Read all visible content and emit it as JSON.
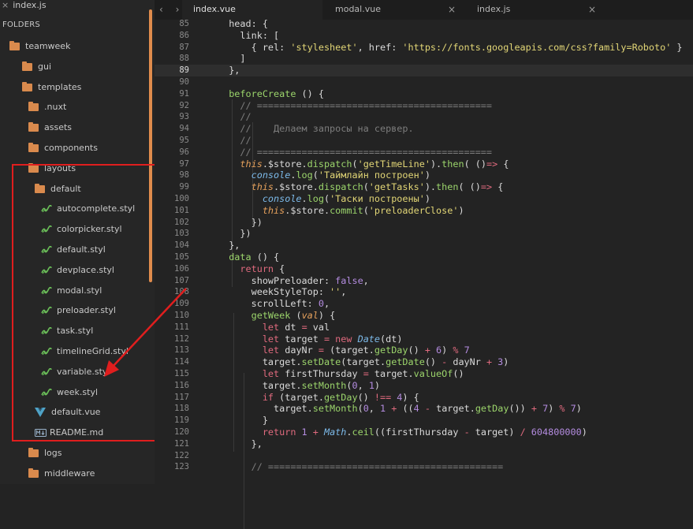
{
  "sidebar": {
    "open_file": "index.js",
    "folders_label": "FOLDERS",
    "items": [
      {
        "label": "teamweek",
        "type": "folder"
      },
      {
        "label": "gui",
        "type": "folder"
      },
      {
        "label": "templates",
        "type": "folder"
      },
      {
        "label": ".nuxt",
        "type": "folder"
      },
      {
        "label": "assets",
        "type": "folder"
      },
      {
        "label": "components",
        "type": "folder"
      },
      {
        "label": "layouts",
        "type": "folder"
      },
      {
        "label": "default",
        "type": "folder"
      },
      {
        "label": "autocomplete.styl",
        "type": "styl"
      },
      {
        "label": "colorpicker.styl",
        "type": "styl"
      },
      {
        "label": "default.styl",
        "type": "styl"
      },
      {
        "label": "devplace.styl",
        "type": "styl"
      },
      {
        "label": "modal.styl",
        "type": "styl"
      },
      {
        "label": "preloader.styl",
        "type": "styl"
      },
      {
        "label": "task.styl",
        "type": "styl"
      },
      {
        "label": "timelineGrid.styl",
        "type": "styl"
      },
      {
        "label": "variable.styl",
        "type": "styl"
      },
      {
        "label": "week.styl",
        "type": "styl"
      },
      {
        "label": "default.vue",
        "type": "vue"
      },
      {
        "label": "README.md",
        "type": "md"
      },
      {
        "label": "logs",
        "type": "folder"
      },
      {
        "label": "middleware",
        "type": "folder"
      }
    ]
  },
  "tabs": [
    {
      "label": "index.vue",
      "active": true
    },
    {
      "label": "modal.vue",
      "active": false
    },
    {
      "label": "index.js",
      "active": false
    }
  ],
  "nav_arrows": "‹ ›",
  "current_line": 89,
  "colors": {
    "annotation_red": "#e01e1e",
    "folder_orange": "#d98a4d",
    "keyword": "#e06a7e",
    "string": "#e2d676",
    "function": "#9bd46b"
  },
  "code_lines": [
    {
      "n": 85,
      "tokens": [
        [
          "a",
          "  head: {"
        ]
      ]
    },
    {
      "n": 86,
      "tokens": [
        [
          "a",
          "    link: ["
        ]
      ]
    },
    {
      "n": 87,
      "tokens": [
        [
          "a",
          "      { rel: "
        ],
        [
          "s",
          "'stylesheet'"
        ],
        [
          "a",
          ", href: "
        ],
        [
          "s",
          "'https://fonts.googleapis.com/css?family=Roboto'"
        ],
        [
          "a",
          " }"
        ]
      ]
    },
    {
      "n": 88,
      "tokens": [
        [
          "a",
          "    ]"
        ]
      ]
    },
    {
      "n": 89,
      "tokens": [
        [
          "a",
          "  },"
        ]
      ]
    },
    {
      "n": 90,
      "tokens": [
        [
          "a",
          ""
        ]
      ]
    },
    {
      "n": 91,
      "tokens": [
        [
          "f",
          "  beforeCreate"
        ],
        [
          "a",
          " () {"
        ]
      ]
    },
    {
      "n": 92,
      "tokens": [
        [
          "c",
          "    // =========================================="
        ]
      ]
    },
    {
      "n": 93,
      "tokens": [
        [
          "c",
          "    //"
        ]
      ]
    },
    {
      "n": 94,
      "tokens": [
        [
          "c",
          "    //    Делаем запросы на сервер."
        ]
      ]
    },
    {
      "n": 95,
      "tokens": [
        [
          "c",
          "    //"
        ]
      ]
    },
    {
      "n": 96,
      "tokens": [
        [
          "c",
          "    // =========================================="
        ]
      ]
    },
    {
      "n": 97,
      "tokens": [
        [
          "i",
          "    this"
        ],
        [
          "a",
          ".$store."
        ],
        [
          "f",
          "dispatch"
        ],
        [
          "a",
          "("
        ],
        [
          "s",
          "'getTimeLine'"
        ],
        [
          "a",
          ")."
        ],
        [
          "f",
          "then"
        ],
        [
          "a",
          "( ()"
        ],
        [
          "k",
          "=>"
        ],
        [
          "a",
          " {"
        ]
      ]
    },
    {
      "n": 98,
      "tokens": [
        [
          "b",
          "      console"
        ],
        [
          "a",
          "."
        ],
        [
          "f",
          "log"
        ],
        [
          "a",
          "("
        ],
        [
          "s",
          "'Таймлайн построен'"
        ],
        [
          "a",
          ")"
        ]
      ]
    },
    {
      "n": 99,
      "tokens": [
        [
          "i",
          "      this"
        ],
        [
          "a",
          ".$store."
        ],
        [
          "f",
          "dispatch"
        ],
        [
          "a",
          "("
        ],
        [
          "s",
          "'getTasks'"
        ],
        [
          "a",
          ")."
        ],
        [
          "f",
          "then"
        ],
        [
          "a",
          "( ()"
        ],
        [
          "k",
          "=>"
        ],
        [
          "a",
          " {"
        ]
      ]
    },
    {
      "n": 100,
      "tokens": [
        [
          "b",
          "        console"
        ],
        [
          "a",
          "."
        ],
        [
          "f",
          "log"
        ],
        [
          "a",
          "("
        ],
        [
          "s",
          "'Таски построены'"
        ],
        [
          "a",
          ")"
        ]
      ]
    },
    {
      "n": 101,
      "tokens": [
        [
          "i",
          "        this"
        ],
        [
          "a",
          ".$store."
        ],
        [
          "f",
          "commit"
        ],
        [
          "a",
          "("
        ],
        [
          "s",
          "'preloaderClose'"
        ],
        [
          "a",
          ")"
        ]
      ]
    },
    {
      "n": 102,
      "tokens": [
        [
          "a",
          "      })"
        ]
      ]
    },
    {
      "n": 103,
      "tokens": [
        [
          "a",
          "    })"
        ]
      ]
    },
    {
      "n": 104,
      "tokens": [
        [
          "a",
          "  },"
        ]
      ]
    },
    {
      "n": 105,
      "tokens": [
        [
          "f",
          "  data"
        ],
        [
          "a",
          " () {"
        ]
      ]
    },
    {
      "n": 106,
      "tokens": [
        [
          "k",
          "    return"
        ],
        [
          "a",
          " {"
        ]
      ]
    },
    {
      "n": 107,
      "tokens": [
        [
          "a",
          "      showPreloader: "
        ],
        [
          "n",
          "false"
        ],
        [
          "a",
          ","
        ]
      ]
    },
    {
      "n": 108,
      "tokens": [
        [
          "a",
          "      weekStyleTop: "
        ],
        [
          "s",
          "''"
        ],
        [
          "a",
          ","
        ]
      ]
    },
    {
      "n": 109,
      "tokens": [
        [
          "a",
          "      scrollLeft: "
        ],
        [
          "n",
          "0"
        ],
        [
          "a",
          ","
        ]
      ]
    },
    {
      "n": 110,
      "tokens": [
        [
          "f",
          "      getWeek"
        ],
        [
          "a",
          " ("
        ],
        [
          "i",
          "val"
        ],
        [
          "a",
          ") {"
        ]
      ]
    },
    {
      "n": 111,
      "tokens": [
        [
          "k",
          "        let"
        ],
        [
          "a",
          " dt "
        ],
        [
          "k",
          "="
        ],
        [
          "a",
          " val"
        ]
      ]
    },
    {
      "n": 112,
      "tokens": [
        [
          "k",
          "        let"
        ],
        [
          "a",
          " target "
        ],
        [
          "k",
          "="
        ],
        [
          "k",
          " new"
        ],
        [
          "b",
          " Date"
        ],
        [
          "a",
          "(dt)"
        ]
      ]
    },
    {
      "n": 113,
      "tokens": [
        [
          "k",
          "        let"
        ],
        [
          "a",
          " dayNr "
        ],
        [
          "k",
          "="
        ],
        [
          "a",
          " (target."
        ],
        [
          "f",
          "getDay"
        ],
        [
          "a",
          "() "
        ],
        [
          "k",
          "+"
        ],
        [
          "n",
          " 6"
        ],
        [
          "a",
          ") "
        ],
        [
          "k",
          "%"
        ],
        [
          "n",
          " 7"
        ]
      ]
    },
    {
      "n": 114,
      "tokens": [
        [
          "a",
          "        target."
        ],
        [
          "f",
          "setDate"
        ],
        [
          "a",
          "(target."
        ],
        [
          "f",
          "getDate"
        ],
        [
          "a",
          "() "
        ],
        [
          "k",
          "-"
        ],
        [
          "a",
          " dayNr "
        ],
        [
          "k",
          "+"
        ],
        [
          "n",
          " 3"
        ],
        [
          "a",
          ")"
        ]
      ]
    },
    {
      "n": 115,
      "tokens": [
        [
          "k",
          "        let"
        ],
        [
          "a",
          " firstThursday "
        ],
        [
          "k",
          "="
        ],
        [
          "a",
          " target."
        ],
        [
          "f",
          "valueOf"
        ],
        [
          "a",
          "()"
        ]
      ]
    },
    {
      "n": 116,
      "tokens": [
        [
          "a",
          "        target."
        ],
        [
          "f",
          "setMonth"
        ],
        [
          "a",
          "("
        ],
        [
          "n",
          "0"
        ],
        [
          "a",
          ", "
        ],
        [
          "n",
          "1"
        ],
        [
          "a",
          ")"
        ]
      ]
    },
    {
      "n": 117,
      "tokens": [
        [
          "k",
          "        if"
        ],
        [
          "a",
          " (target."
        ],
        [
          "f",
          "getDay"
        ],
        [
          "a",
          "() "
        ],
        [
          "k",
          "!=="
        ],
        [
          "n",
          " 4"
        ],
        [
          "a",
          ") {"
        ]
      ]
    },
    {
      "n": 118,
      "tokens": [
        [
          "a",
          "          target."
        ],
        [
          "f",
          "setMonth"
        ],
        [
          "a",
          "("
        ],
        [
          "n",
          "0"
        ],
        [
          "a",
          ", "
        ],
        [
          "n",
          "1"
        ],
        [
          "k",
          " +"
        ],
        [
          "a",
          " (("
        ],
        [
          "n",
          "4"
        ],
        [
          "k",
          " -"
        ],
        [
          "a",
          " target."
        ],
        [
          "f",
          "getDay"
        ],
        [
          "a",
          "()) "
        ],
        [
          "k",
          "+"
        ],
        [
          "n",
          " 7"
        ],
        [
          "a",
          ") "
        ],
        [
          "k",
          "%"
        ],
        [
          "n",
          " 7"
        ],
        [
          "a",
          ")"
        ]
      ]
    },
    {
      "n": 119,
      "tokens": [
        [
          "a",
          "        }"
        ]
      ]
    },
    {
      "n": 120,
      "tokens": [
        [
          "k",
          "        return"
        ],
        [
          "n",
          " 1"
        ],
        [
          "k",
          " +"
        ],
        [
          "b",
          " Math"
        ],
        [
          "a",
          "."
        ],
        [
          "f",
          "ceil"
        ],
        [
          "a",
          "((firstThursday "
        ],
        [
          "k",
          "-"
        ],
        [
          "a",
          " target) "
        ],
        [
          "k",
          "/"
        ],
        [
          "n",
          " 604800000"
        ],
        [
          "a",
          ")"
        ]
      ]
    },
    {
      "n": 121,
      "tokens": [
        [
          "a",
          "      },"
        ]
      ]
    },
    {
      "n": 122,
      "tokens": [
        [
          "a",
          ""
        ]
      ]
    },
    {
      "n": 123,
      "tokens": [
        [
          "c",
          "      // =========================================="
        ]
      ]
    }
  ]
}
